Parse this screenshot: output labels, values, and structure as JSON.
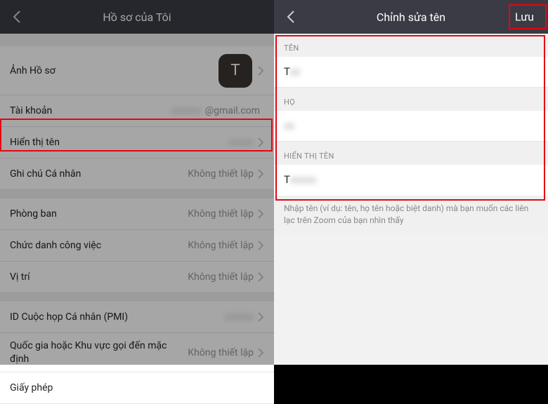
{
  "left": {
    "header_title": "Hồ sơ của Tôi",
    "rows": {
      "profile_photo_label": "Ảnh Hồ sơ",
      "avatar_letter": "T",
      "account_label": "Tài khoản",
      "account_value": "@gmail.com",
      "display_name_label": "Hiển thị tên",
      "personal_note_label": "Ghi chú Cá nhân",
      "personal_note_value": "Không thiết lập",
      "department_label": "Phòng ban",
      "department_value": "Không thiết lập",
      "job_title_label": "Chức danh công việc",
      "job_title_value": "Không thiết lập",
      "location_label": "Vị trí",
      "location_value": "Không thiết lập",
      "pmi_label": "ID Cuộc họp Cá nhân (PMI)",
      "default_region_label": "Quốc gia hoặc Khu vực gọi đến mặc định",
      "default_region_value": "Không thiết lập",
      "license_label": "Giấy phép"
    }
  },
  "right": {
    "header_title": "Chỉnh sửa tên",
    "save_label": "Lưu",
    "first_name_section": "TÊN",
    "first_name_value": "T",
    "last_name_section": "HỌ",
    "display_name_section": "HIỂN THỊ TÊN",
    "display_name_value": "T",
    "helper_text": "Nhập tên (ví dụ: tên, họ tên hoặc biệt danh) mà bạn muốn các liên lạc trên Zoom của bạn nhìn thấy"
  }
}
